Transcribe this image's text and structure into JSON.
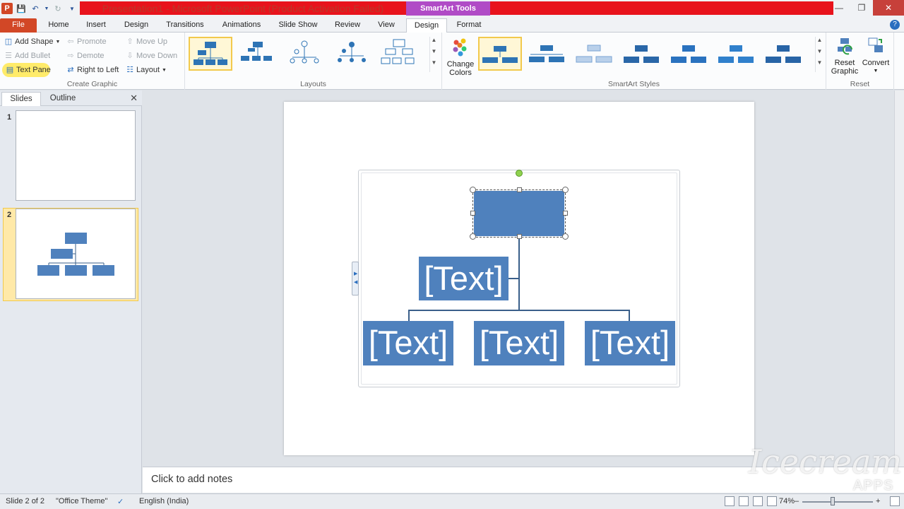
{
  "window": {
    "title": "Presentation1  -  Microsoft PowerPoint (Product Activation Failed)",
    "contextual_tab_group": "SmartArt Tools"
  },
  "tabs": [
    {
      "label": "File",
      "left": 0,
      "width": 52
    },
    {
      "label": "Home"
    },
    {
      "label": "Insert"
    },
    {
      "label": "Design"
    },
    {
      "label": "Transitions"
    },
    {
      "label": "Animations"
    },
    {
      "label": "Slide Show"
    },
    {
      "label": "Review"
    },
    {
      "label": "View"
    },
    {
      "label": "Design"
    },
    {
      "label": "Format"
    }
  ],
  "ribbon": {
    "create_graphic": {
      "label": "Create Graphic",
      "add_shape": "Add Shape",
      "add_bullet": "Add Bullet",
      "text_pane": "Text Pane",
      "promote": "Promote",
      "demote": "Demote",
      "right_to_left": "Right to Left",
      "move_up": "Move Up",
      "move_down": "Move Down",
      "layout": "Layout"
    },
    "layouts": {
      "label": "Layouts"
    },
    "smartart_styles": {
      "label": "SmartArt Styles",
      "change_colors": "Change Colors"
    },
    "reset": {
      "label": "Reset",
      "reset_graphic": "Reset Graphic",
      "convert": "Convert"
    }
  },
  "slides_pane": {
    "tabs": [
      "Slides",
      "Outline"
    ],
    "slides": [
      "1",
      "2"
    ]
  },
  "smartart": {
    "placeholder": "[Text]"
  },
  "notes": {
    "placeholder": "Click to add notes"
  },
  "status": {
    "slide": "Slide 2 of 2",
    "theme": "\"Office Theme\"",
    "language": "English (India)",
    "zoom": "74%"
  },
  "watermark": {
    "brand": "Icecream",
    "sub": "APPS"
  },
  "colors": {
    "accent": "#4f81bd",
    "file_tab": "#d24726",
    "smartart_tools": "#b04bc6",
    "title_band": "#e8131c"
  }
}
